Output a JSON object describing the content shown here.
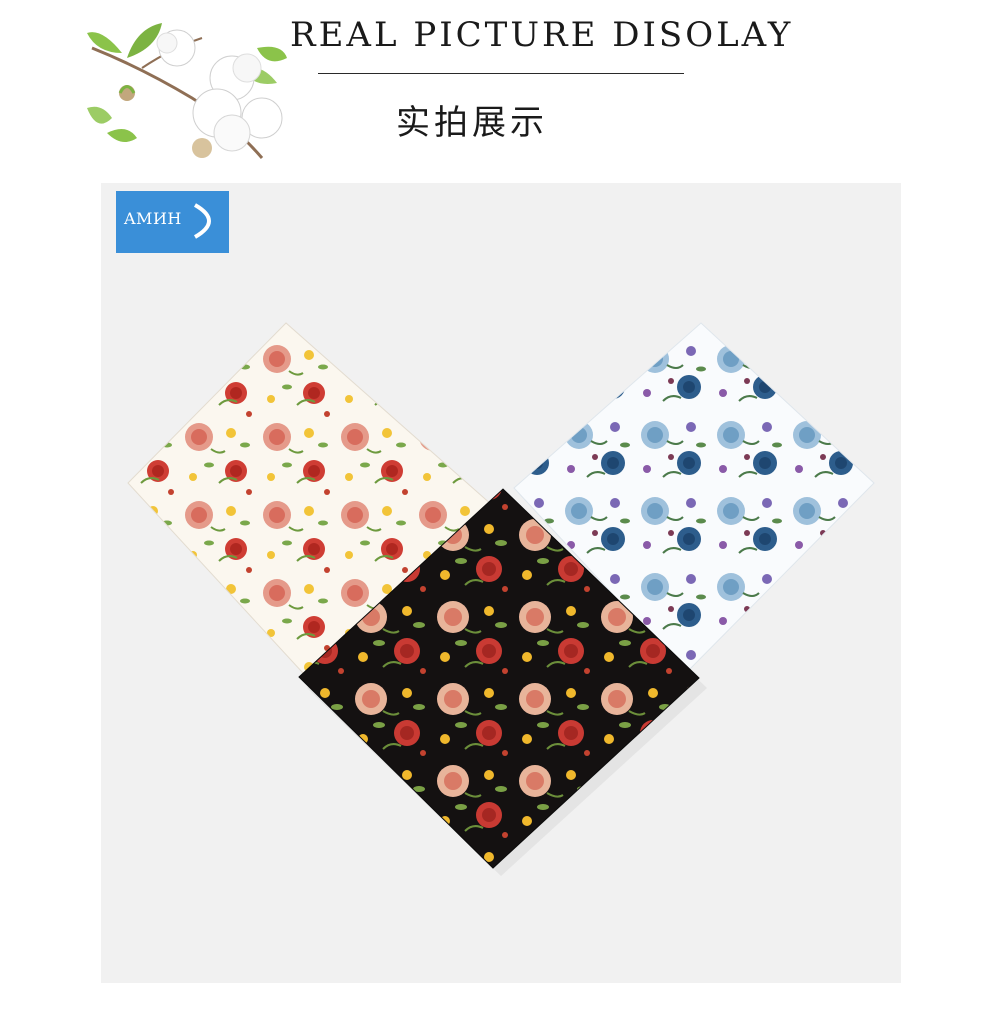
{
  "header": {
    "title_en": "REAL PICTURE DISOLAY",
    "title_cn": "实拍展示",
    "illustration_icon": "cotton-branch-illustration"
  },
  "photo": {
    "brand_logo": "AMИH",
    "background_color": "#f1f1f1",
    "items": [
      {
        "name": "white-rose-handkerchief",
        "ground": "#fbf7ef"
      },
      {
        "name": "blue-floral-handkerchief",
        "ground": "#f9fbfd"
      },
      {
        "name": "black-rose-handkerchief",
        "ground": "#141111"
      }
    ]
  }
}
